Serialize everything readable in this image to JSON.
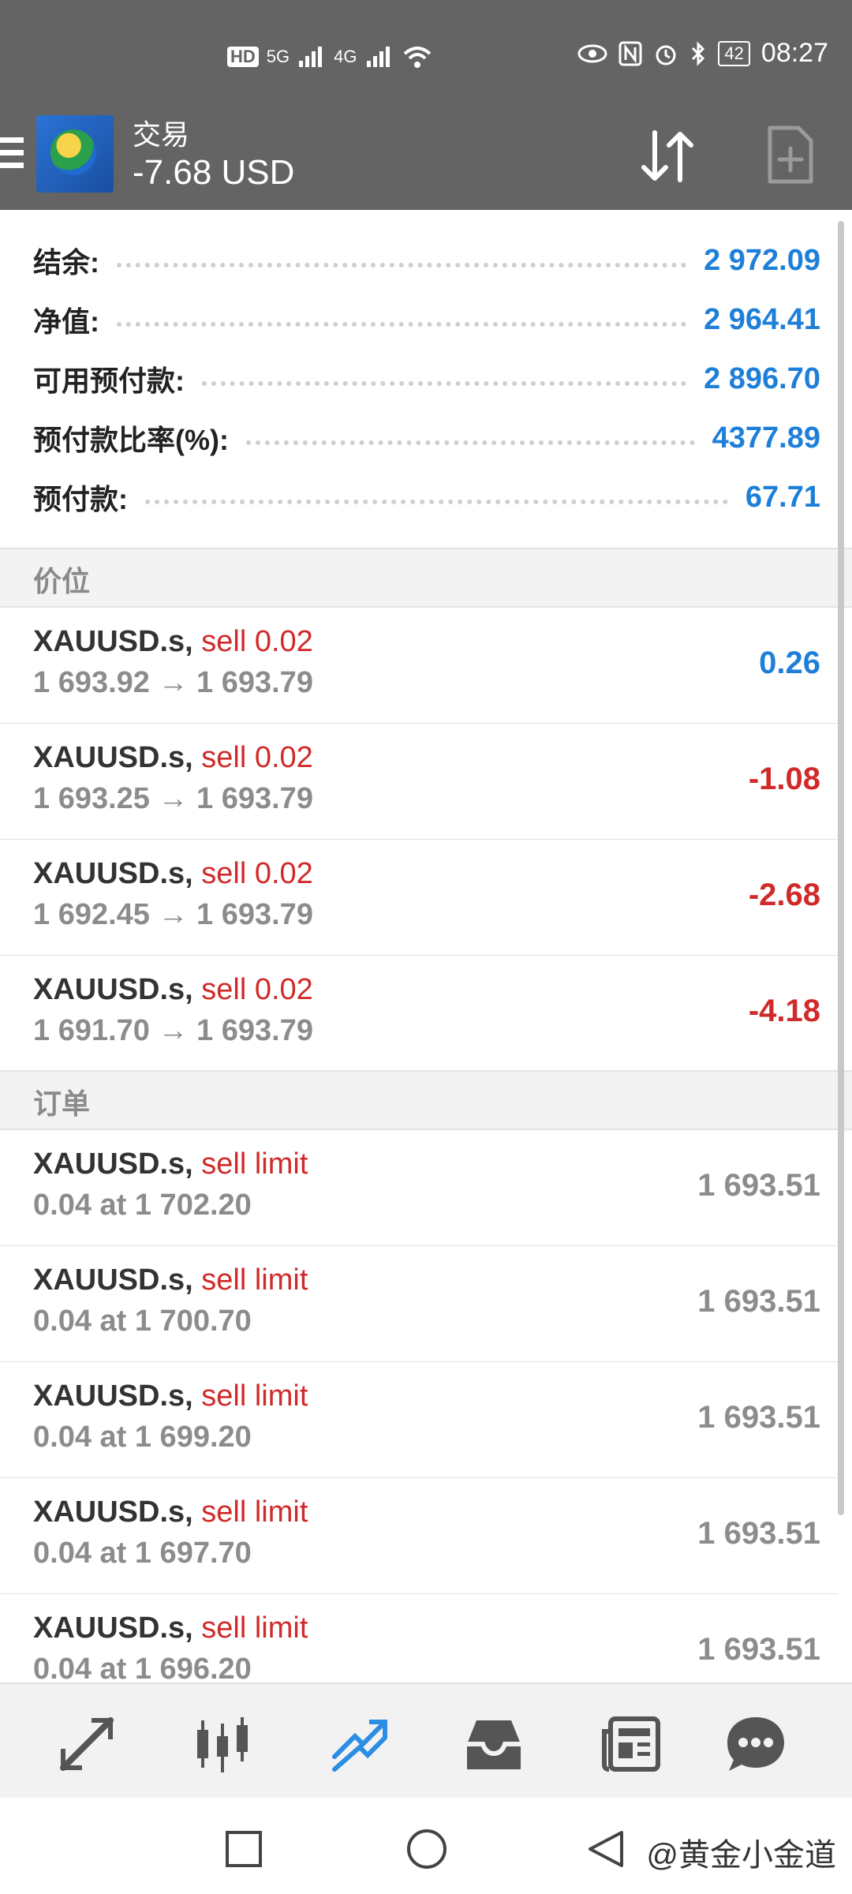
{
  "status_bar": {
    "left_indicators": [
      "HD",
      "5G",
      "4G"
    ],
    "battery": "42",
    "time": "08:27"
  },
  "app_bar": {
    "title": "交易",
    "profit": "-7.68 USD"
  },
  "balances": [
    {
      "label": "结余:",
      "value": "2 972.09"
    },
    {
      "label": "净值:",
      "value": "2 964.41"
    },
    {
      "label": "可用预付款:",
      "value": "2 896.70"
    },
    {
      "label": "预付款比率(%):",
      "value": "4377.89"
    },
    {
      "label": "预付款:",
      "value": "67.71"
    }
  ],
  "positions_header": "价位",
  "positions": [
    {
      "symbol": "XAUUSD.s,",
      "side": "sell 0.02",
      "prices": "1 693.92 → 1 693.79",
      "profit": "0.26"
    },
    {
      "symbol": "XAUUSD.s,",
      "side": "sell 0.02",
      "prices": "1 693.25 → 1 693.79",
      "profit": "-1.08"
    },
    {
      "symbol": "XAUUSD.s,",
      "side": "sell 0.02",
      "prices": "1 692.45 → 1 693.79",
      "profit": "-2.68"
    },
    {
      "symbol": "XAUUSD.s,",
      "side": "sell 0.02",
      "prices": "1 691.70 → 1 693.79",
      "profit": "-4.18"
    }
  ],
  "orders_header": "订单",
  "orders": [
    {
      "symbol": "XAUUSD.s,",
      "side": "sell limit",
      "detail": "0.04 at 1 702.20",
      "price": "1 693.51"
    },
    {
      "symbol": "XAUUSD.s,",
      "side": "sell limit",
      "detail": "0.04 at 1 700.70",
      "price": "1 693.51"
    },
    {
      "symbol": "XAUUSD.s,",
      "side": "sell limit",
      "detail": "0.04 at 1 699.20",
      "price": "1 693.51"
    },
    {
      "symbol": "XAUUSD.s,",
      "side": "sell limit",
      "detail": "0.04 at 1 697.70",
      "price": "1 693.51"
    },
    {
      "symbol": "XAUUSD.s,",
      "side": "sell limit",
      "detail": "0.04 at 1 696.20",
      "price": "1 693.51"
    }
  ],
  "bottom_nav": [
    {
      "icon": "quotes-icon",
      "active": false
    },
    {
      "icon": "chart-icon",
      "active": false
    },
    {
      "icon": "trade-icon",
      "active": true
    },
    {
      "icon": "history-icon",
      "active": false
    },
    {
      "icon": "news-icon",
      "active": false
    },
    {
      "icon": "messages-icon",
      "active": false
    }
  ],
  "watermark": "@黄金小金道",
  "colors": {
    "accent": "#1e7fd8",
    "loss": "#d02a2a",
    "appbar": "#646464",
    "active_nav": "#2b8de3"
  }
}
